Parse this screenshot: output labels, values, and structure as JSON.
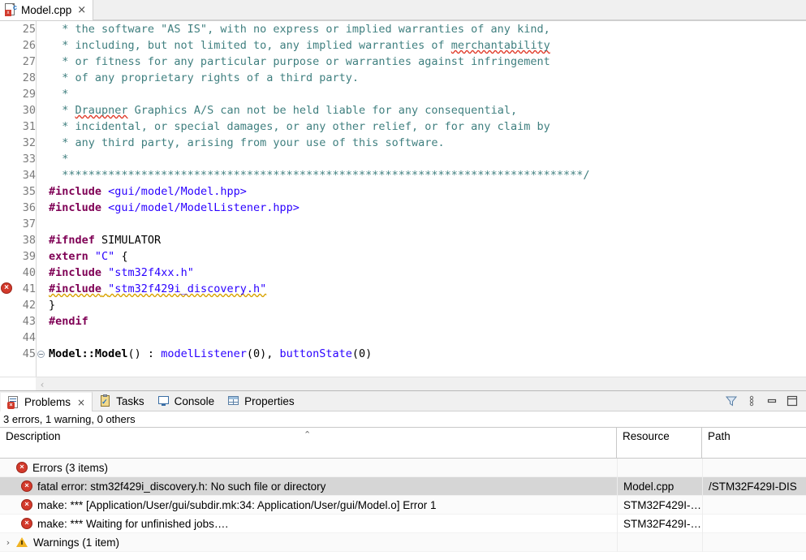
{
  "editor": {
    "tab": {
      "label": "Model.cpp",
      "close": "×",
      "icon": "cpp-file-icon",
      "icon_letter_c": "c",
      "icon_badge": "x"
    },
    "scroll_left_arrow": "‹",
    "lines": [
      {
        "num": "25",
        "marker": null,
        "fold": false,
        "segments": [
          {
            "text": "  * the software \"AS IS\", with no express or implied warranties of any kind,",
            "cls": "cmt"
          }
        ]
      },
      {
        "num": "26",
        "marker": null,
        "fold": false,
        "segments": [
          {
            "text": "  * including, but not limited to, any implied warranties of ",
            "cls": "cmt"
          },
          {
            "text": "merchantability",
            "cls": "cmt sq-red"
          }
        ]
      },
      {
        "num": "27",
        "marker": null,
        "fold": false,
        "segments": [
          {
            "text": "  * or fitness for any particular purpose or warranties against infringement",
            "cls": "cmt"
          }
        ]
      },
      {
        "num": "28",
        "marker": null,
        "fold": false,
        "segments": [
          {
            "text": "  * of any proprietary rights of a third party.",
            "cls": "cmt"
          }
        ]
      },
      {
        "num": "29",
        "marker": null,
        "fold": false,
        "segments": [
          {
            "text": "  *",
            "cls": "cmt"
          }
        ]
      },
      {
        "num": "30",
        "marker": null,
        "fold": false,
        "segments": [
          {
            "text": "  * ",
            "cls": "cmt"
          },
          {
            "text": "Draupner",
            "cls": "cmt sq-red"
          },
          {
            "text": " Graphics A/S can not be held liable for any consequential,",
            "cls": "cmt"
          }
        ]
      },
      {
        "num": "31",
        "marker": null,
        "fold": false,
        "segments": [
          {
            "text": "  * incidental, or special damages, or any other relief, or for any claim by",
            "cls": "cmt"
          }
        ]
      },
      {
        "num": "32",
        "marker": null,
        "fold": false,
        "segments": [
          {
            "text": "  * any third party, arising from your use of this software.",
            "cls": "cmt"
          }
        ]
      },
      {
        "num": "33",
        "marker": null,
        "fold": false,
        "segments": [
          {
            "text": "  *",
            "cls": "cmt"
          }
        ]
      },
      {
        "num": "34",
        "marker": null,
        "fold": false,
        "segments": [
          {
            "text": "  *******************************************************************************/",
            "cls": "cmt"
          }
        ]
      },
      {
        "num": "35",
        "marker": null,
        "fold": false,
        "segments": [
          {
            "text": "#include",
            "cls": "kw"
          },
          {
            "text": " ",
            "cls": "plain"
          },
          {
            "text": "<gui/model/Model.hpp>",
            "cls": "str"
          }
        ]
      },
      {
        "num": "36",
        "marker": null,
        "fold": false,
        "segments": [
          {
            "text": "#include",
            "cls": "kw"
          },
          {
            "text": " ",
            "cls": "plain"
          },
          {
            "text": "<gui/model/ModelListener.hpp>",
            "cls": "str"
          }
        ]
      },
      {
        "num": "37",
        "marker": null,
        "fold": false,
        "segments": [
          {
            "text": "",
            "cls": "plain"
          }
        ]
      },
      {
        "num": "38",
        "marker": null,
        "fold": false,
        "segments": [
          {
            "text": "#ifndef",
            "cls": "kw"
          },
          {
            "text": " SIMULATOR",
            "cls": "plain"
          }
        ]
      },
      {
        "num": "39",
        "marker": null,
        "fold": false,
        "segments": [
          {
            "text": "extern",
            "cls": "kw"
          },
          {
            "text": " ",
            "cls": "plain"
          },
          {
            "text": "\"C\"",
            "cls": "str"
          },
          {
            "text": " {",
            "cls": "plain"
          }
        ]
      },
      {
        "num": "40",
        "marker": null,
        "fold": false,
        "segments": [
          {
            "text": "#include",
            "cls": "kw"
          },
          {
            "text": " ",
            "cls": "plain"
          },
          {
            "text": "\"stm32f4xx.h\"",
            "cls": "str"
          }
        ]
      },
      {
        "num": "41",
        "marker": "error",
        "fold": false,
        "segments": [
          {
            "text": "#include",
            "cls": "kw sq-yellow"
          },
          {
            "text": " ",
            "cls": "plain sq-yellow"
          },
          {
            "text": "\"stm32f429i_discovery.h\"",
            "cls": "str sq-yellow"
          }
        ]
      },
      {
        "num": "42",
        "marker": null,
        "fold": false,
        "segments": [
          {
            "text": "}",
            "cls": "plain"
          }
        ]
      },
      {
        "num": "43",
        "marker": null,
        "fold": false,
        "segments": [
          {
            "text": "#endif",
            "cls": "kw"
          }
        ]
      },
      {
        "num": "44",
        "marker": null,
        "fold": false,
        "segments": [
          {
            "text": "",
            "cls": "plain"
          }
        ]
      },
      {
        "num": "45",
        "marker": null,
        "fold": true,
        "segments": [
          {
            "text": "Model::Model",
            "cls": "bold"
          },
          {
            "text": "() : ",
            "cls": "plain"
          },
          {
            "text": "modelListener",
            "cls": "blue"
          },
          {
            "text": "(0), ",
            "cls": "plain"
          },
          {
            "text": "buttonState",
            "cls": "blue"
          },
          {
            "text": "(0)",
            "cls": "plain"
          }
        ]
      }
    ]
  },
  "problems_view": {
    "tabs": [
      {
        "label": "Problems",
        "icon": "problems-icon",
        "active": true,
        "close": "×"
      },
      {
        "label": "Tasks",
        "icon": "tasks-icon",
        "active": false,
        "close": ""
      },
      {
        "label": "Console",
        "icon": "console-icon",
        "active": false,
        "close": ""
      },
      {
        "label": "Properties",
        "icon": "properties-icon",
        "active": false,
        "close": ""
      }
    ],
    "toolbar": [
      {
        "name": "filter-icon",
        "title": "Filters"
      },
      {
        "name": "view-menu-icon",
        "title": "View Menu"
      },
      {
        "name": "minimize-icon",
        "title": "Minimize"
      },
      {
        "name": "maximize-icon",
        "title": "Maximize"
      }
    ],
    "status": "3 errors, 1 warning, 0 others",
    "columns": {
      "description": "Description",
      "resource": "Resource",
      "path": "Path",
      "sort_caret": "⌃"
    },
    "rows": [
      {
        "kind": "group",
        "twisty": "ⱟ",
        "icon": "error-icon",
        "description": "Errors (3 items)",
        "resource": "",
        "path": "",
        "selected": false
      },
      {
        "kind": "item",
        "twisty": "",
        "icon": "error-icon",
        "description": "fatal error: stm32f429i_discovery.h: No such file or directory",
        "resource": "Model.cpp",
        "path": "/STM32F429I-DIS",
        "selected": true
      },
      {
        "kind": "item",
        "twisty": "",
        "icon": "error-icon",
        "description": "make: *** [Application/User/gui/subdir.mk:34: Application/User/gui/Model.o] Error 1",
        "resource": "STM32F429I-…",
        "path": "",
        "selected": false
      },
      {
        "kind": "item",
        "twisty": "",
        "icon": "error-icon",
        "description": "make: *** Waiting for unfinished jobs….",
        "resource": "STM32F429I-…",
        "path": "",
        "selected": false
      },
      {
        "kind": "group",
        "twisty": "›",
        "icon": "warning-icon",
        "description": "Warnings (1 item)",
        "resource": "",
        "path": "",
        "selected": false
      }
    ]
  },
  "colors": {
    "error_red": "#d33a2c",
    "warning_yellow": "#f0b323",
    "comment_teal": "#3f7f7f",
    "keyword_purple": "#7f0055",
    "string_blue": "#2a00ff",
    "selection_gray": "#d6d6d6"
  }
}
